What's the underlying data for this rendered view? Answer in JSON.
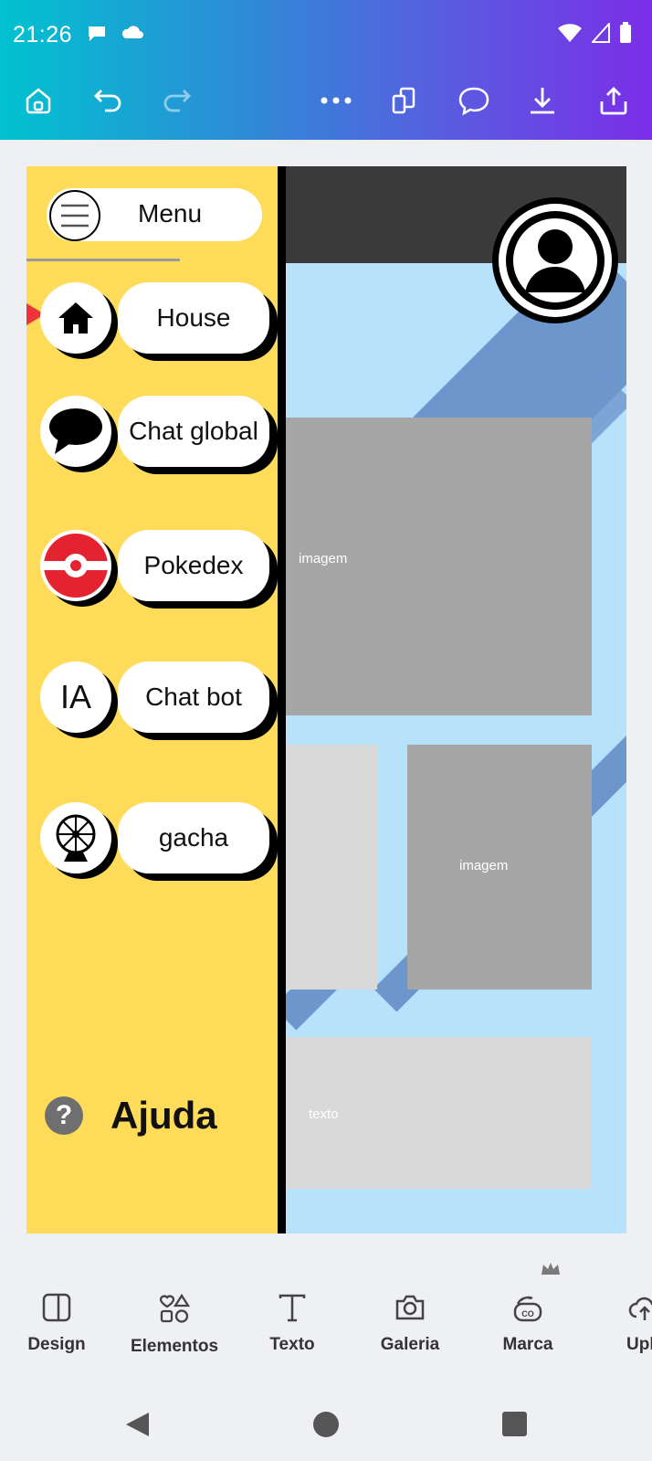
{
  "status_bar": {
    "time": "21:26"
  },
  "toolbar": {
    "icons": [
      "home-icon",
      "undo-icon",
      "redo-icon",
      "more-icon",
      "pages-icon",
      "comment-icon",
      "download-icon",
      "share-icon"
    ]
  },
  "design": {
    "menu_label": "Menu",
    "nav": [
      {
        "label": "House",
        "icon": "house-icon"
      },
      {
        "label": "Chat global",
        "icon": "chat-bubble-icon"
      },
      {
        "label": "Pokedex",
        "icon": "pokeball-icon"
      },
      {
        "label": "Chat bot",
        "icon": "ia-icon",
        "icon_text": "IA"
      },
      {
        "label": "gacha",
        "icon": "gacha-wheel-icon"
      }
    ],
    "help_label": "Ajuda",
    "image_label_1": "imagem",
    "image_label_2": "imagem",
    "text_label": "texto",
    "colors": {
      "sidebar": "#fedc59",
      "background": "#b8e1fb",
      "stripe": "#6d96cd",
      "placeholder": "#a6a6a6",
      "placeholder_light": "#d9d9d9",
      "accent_arrow": "#f0323c"
    }
  },
  "bottom_nav": [
    {
      "label": "Design",
      "icon": "design-icon"
    },
    {
      "label": "Elementos",
      "icon": "elements-icon"
    },
    {
      "label": "Texto",
      "icon": "text-icon"
    },
    {
      "label": "Galeria",
      "icon": "camera-icon"
    },
    {
      "label": "Marca",
      "icon": "brand-icon"
    },
    {
      "label": "Uploa",
      "icon": "upload-icon"
    }
  ]
}
